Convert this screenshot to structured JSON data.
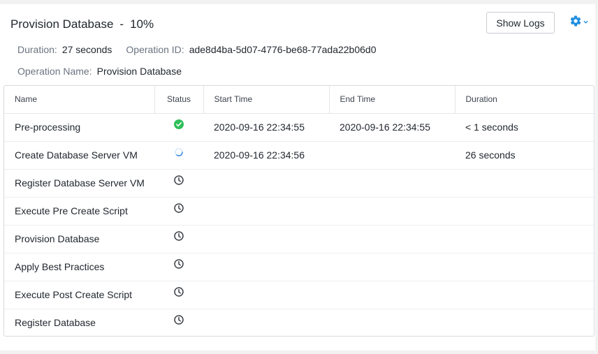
{
  "header": {
    "title": "Provision Database",
    "separator": "-",
    "progress_text": "10%",
    "show_logs_label": "Show Logs",
    "settings_icon": "gear-icon"
  },
  "meta": {
    "duration_label": "Duration:",
    "duration_value": "27 seconds",
    "operation_id_label": "Operation ID:",
    "operation_id_value": "ade8d4ba-5d07-4776-be68-77ada22b06d0",
    "operation_name_label": "Operation Name:",
    "operation_name_value": "Provision Database"
  },
  "table": {
    "columns": [
      "Name",
      "Status",
      "Start Time",
      "End Time",
      "Duration"
    ],
    "rows": [
      {
        "name": "Pre-processing",
        "status": "completed",
        "start": "2020-09-16 22:34:55",
        "end": "2020-09-16 22:34:55",
        "duration": "< 1 seconds"
      },
      {
        "name": "Create Database Server VM",
        "status": "running",
        "start": "2020-09-16 22:34:56",
        "end": "",
        "duration": "26 seconds"
      },
      {
        "name": "Register Database Server VM",
        "status": "pending",
        "start": "",
        "end": "",
        "duration": ""
      },
      {
        "name": "Execute Pre Create Script",
        "status": "pending",
        "start": "",
        "end": "",
        "duration": ""
      },
      {
        "name": "Provision Database",
        "status": "pending",
        "start": "",
        "end": "",
        "duration": ""
      },
      {
        "name": "Apply Best Practices",
        "status": "pending",
        "start": "",
        "end": "",
        "duration": ""
      },
      {
        "name": "Execute Post Create Script",
        "status": "pending",
        "start": "",
        "end": "",
        "duration": ""
      },
      {
        "name": "Register Database",
        "status": "pending",
        "start": "",
        "end": "",
        "duration": ""
      }
    ]
  },
  "colors": {
    "completed": "#2fbf5a",
    "running": "#3d8fe0",
    "pending": "#3b3f45",
    "accent": "#1f8fe0"
  }
}
